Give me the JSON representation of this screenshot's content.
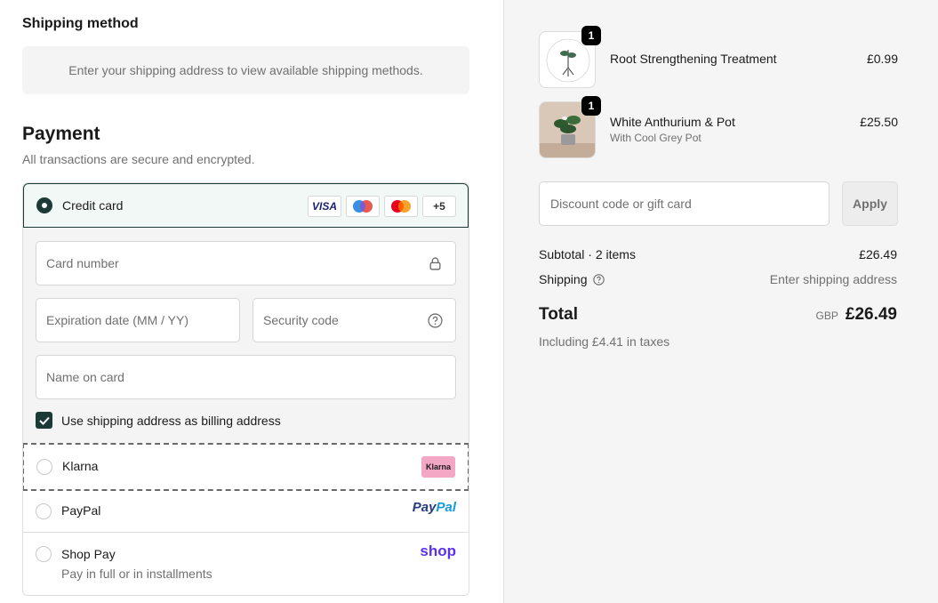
{
  "shipping": {
    "heading": "Shipping method",
    "notice": "Enter your shipping address to view available shipping methods."
  },
  "payment": {
    "heading": "Payment",
    "subtitle": "All transactions are secure and encrypted.",
    "credit_card": {
      "label": "Credit card",
      "selected": true,
      "brands": [
        "VISA",
        "Maestro",
        "Mastercard"
      ],
      "more_label": "+5",
      "card_number_placeholder": "Card number",
      "expiry_placeholder": "Expiration date (MM / YY)",
      "security_placeholder": "Security code",
      "name_placeholder": "Name on card",
      "billing_checkbox_label": "Use shipping address as billing address",
      "billing_checked": true
    },
    "klarna": {
      "label": "Klarna",
      "badge": "Klarna"
    },
    "paypal": {
      "label": "PayPal",
      "logo_a": "Pay",
      "logo_b": "Pal"
    },
    "shop_pay": {
      "label": "Shop Pay",
      "sublabel": "Pay in full or in installments",
      "logo": "shop"
    }
  },
  "order": {
    "items": [
      {
        "name": "Root Strengthening Treatment",
        "variant": "",
        "price": "£0.99",
        "qty": "1",
        "thumb_icon": "plant-root-logo"
      },
      {
        "name": "White Anthurium & Pot",
        "variant": "With Cool Grey Pot",
        "price": "£25.50",
        "qty": "1",
        "thumb_icon": "potted-plant-photo"
      }
    ],
    "discount_placeholder": "Discount code or gift card",
    "apply_label": "Apply",
    "subtotal_label": "Subtotal · 2 items",
    "subtotal_value": "£26.49",
    "shipping_label": "Shipping",
    "shipping_value": "Enter shipping address",
    "total_label": "Total",
    "currency": "GBP",
    "total_value": "£26.49",
    "tax_note": "Including £4.41 in taxes"
  },
  "colors": {
    "accent": "#1d3b36",
    "selected_bg": "#f1f8f6",
    "klarna_pink": "#f4a6c5",
    "shop_purple": "#5a31f4"
  }
}
